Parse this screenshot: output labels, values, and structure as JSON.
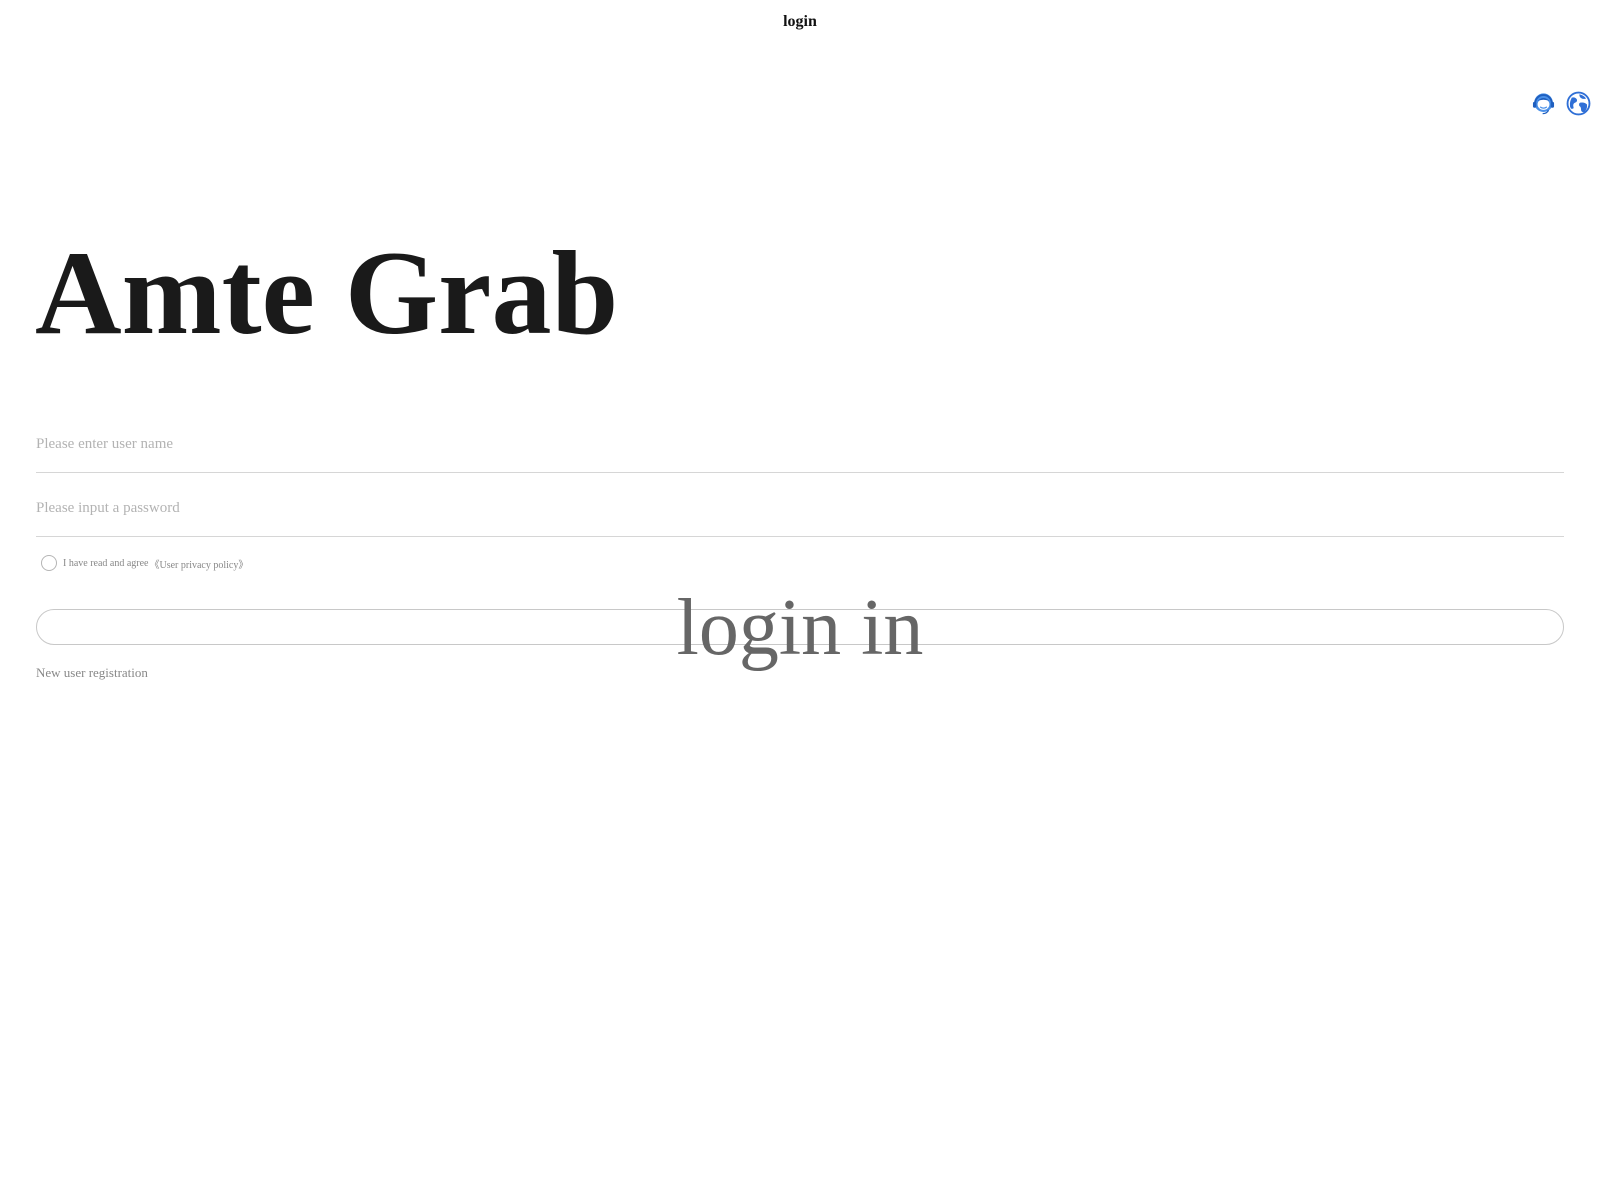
{
  "header": {
    "title": "login"
  },
  "toolbar": {
    "icons": [
      "customer-service-icon",
      "globe-icon"
    ],
    "accent": "#2f7de1"
  },
  "brand": {
    "title": "Amte Grab"
  },
  "form": {
    "username_placeholder": "Please enter user name",
    "password_placeholder": "Please input a password",
    "agree_text": "I have read and agree",
    "privacy_link": "《User privacy policy》",
    "login_label": "login in",
    "register_link": "New user registration"
  },
  "colors": {
    "title_text": "#1a1a1a",
    "muted_text": "#888888",
    "placeholder": "#b3b3b3",
    "border": "#d6d6d6"
  }
}
